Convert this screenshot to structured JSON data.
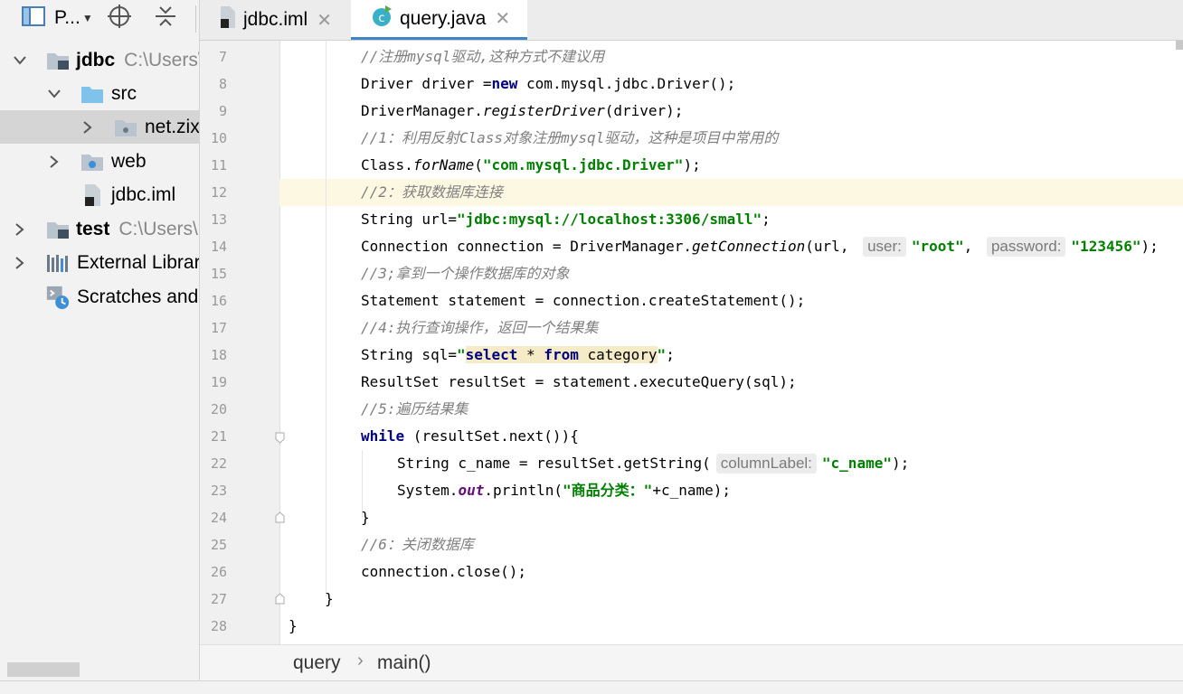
{
  "project_panel": {
    "title": "P...",
    "tree": [
      {
        "label": "jdbc",
        "path": "C:\\Users\\",
        "bold": true
      },
      {
        "label": "src"
      },
      {
        "label": "net.zixue"
      },
      {
        "label": "web"
      },
      {
        "label": "jdbc.iml"
      },
      {
        "label": "test",
        "path": "C:\\Users\\",
        "bold": true
      },
      {
        "label": "External Libraries"
      },
      {
        "label": "Scratches and Consoles"
      }
    ]
  },
  "tabs": [
    {
      "label": "jdbc.iml",
      "active": false
    },
    {
      "label": "query.java",
      "active": true
    }
  ],
  "editor": {
    "line_numbers": [
      "7",
      "8",
      "9",
      "10",
      "11",
      "12",
      "13",
      "14",
      "15",
      "16",
      "17",
      "18",
      "19",
      "20",
      "21",
      "22",
      "23",
      "24",
      "25",
      "26",
      "27",
      "28"
    ],
    "current_line": "12",
    "hints": {
      "user": "user:",
      "password": "password:",
      "column_label": "columnLabel:"
    }
  },
  "breadcrumb": {
    "items": [
      "query",
      "main()"
    ],
    "separator": "›"
  },
  "colors": {
    "accent": "#4083c9",
    "keyword": "#000080",
    "string": "#008000",
    "comment": "#808080"
  }
}
